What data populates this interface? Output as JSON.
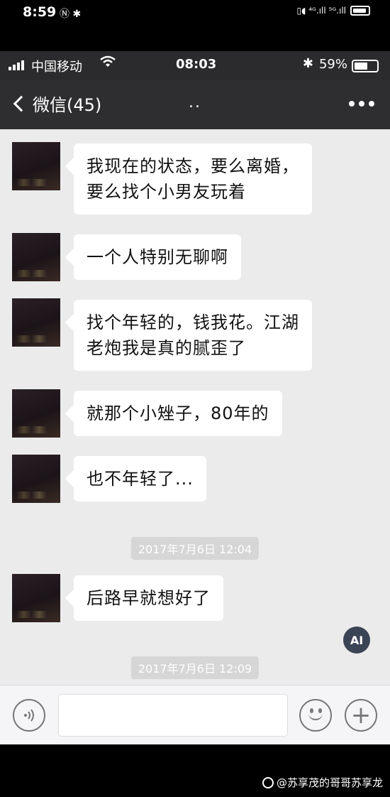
{
  "outer_status": {
    "time": "8:59",
    "left_icons": "Ⓝ ✱",
    "right_icons": "▯◖ ⁴ᴳ.ıll ⁵ᴳ.ıll"
  },
  "inner_status": {
    "carrier": "中国移动",
    "time": "08:03",
    "bluetooth": "✱",
    "battery_pct": "59%",
    "battery_level": 0.59
  },
  "navbar": {
    "back_label": "微信(45)",
    "title": ".."
  },
  "messages": [
    {
      "text_line1": "我现在的状态，要么离婚，",
      "text_line2": "要么找个小男友玩着"
    },
    {
      "text_line1": "一个人特别无聊啊"
    },
    {
      "text_line1": "找个年轻的，钱我花。江湖",
      "text_line2": "老炮我是真的腻歪了"
    },
    {
      "text_line1": "就那个小矬子，80年的"
    },
    {
      "text_line1": "也不年轻了..."
    },
    {
      "text_line1": "后路早就想好了"
    }
  ],
  "timestamps": [
    "2017年7月6日 12:04",
    "2017年7月6日 12:09"
  ],
  "ai_badge": "AI",
  "watermark": "@苏享茂的哥哥苏享龙",
  "icons": {
    "voice": "voice-icon",
    "emoji": "emoji-icon",
    "plus": "plus-icon",
    "back": "chevron-left-icon",
    "more": "more-icon"
  }
}
